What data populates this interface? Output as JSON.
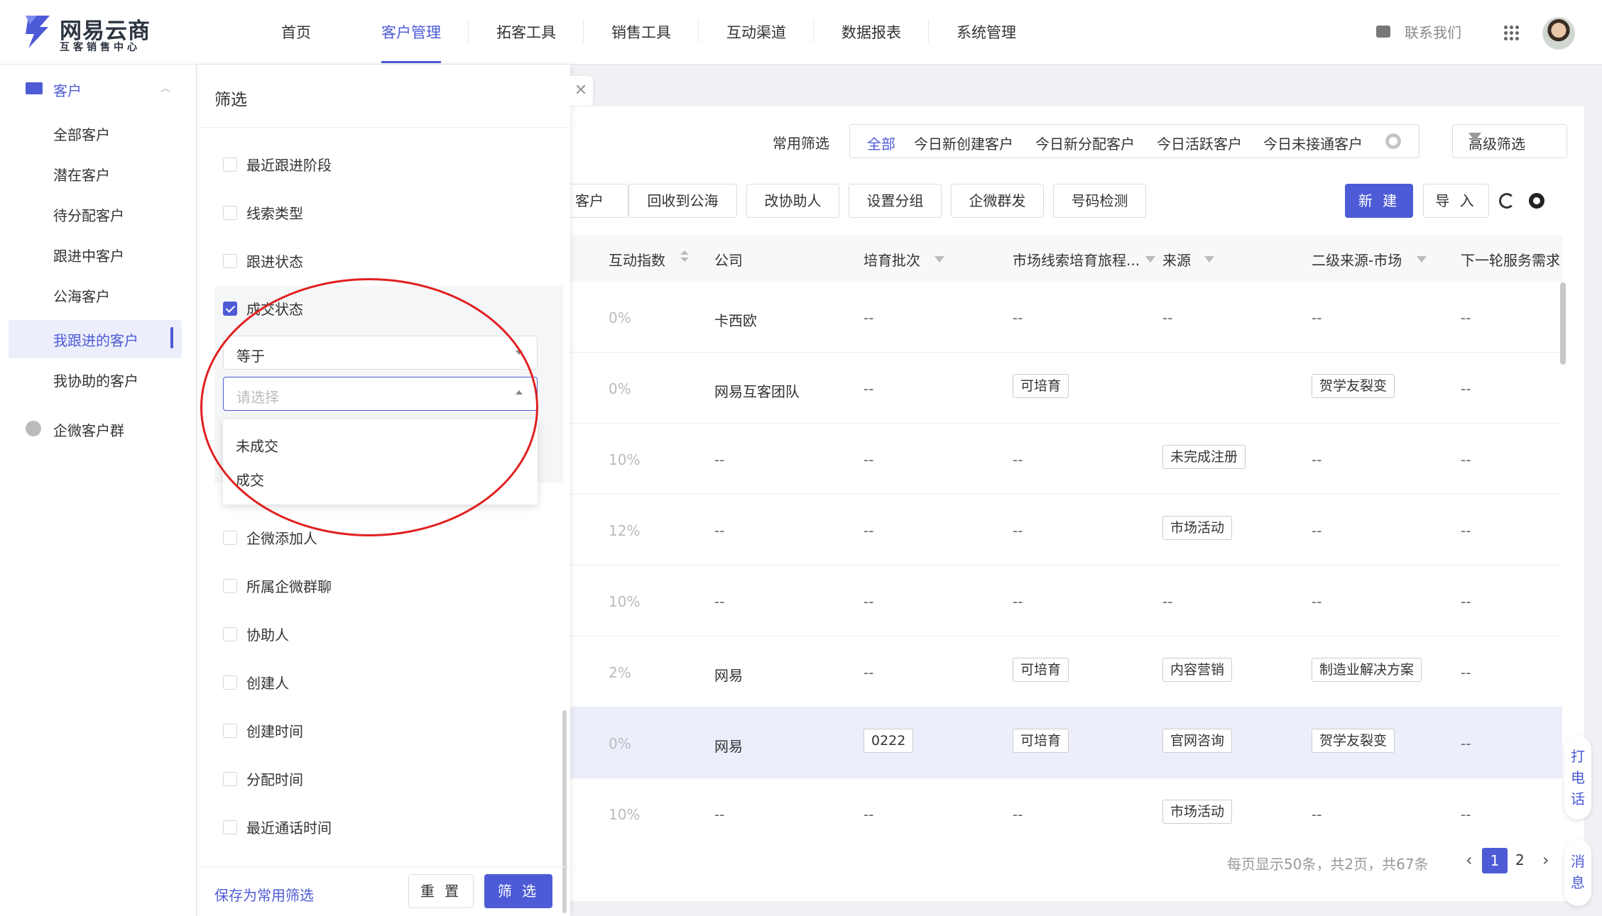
{
  "brand": {
    "name": "网易云商",
    "subtitle": "互客销售中心"
  },
  "nav": {
    "items": [
      "首页",
      "客户管理",
      "拓客工具",
      "销售工具",
      "互动渠道",
      "数据报表",
      "系统管理"
    ],
    "active_index": 1,
    "contact": "联系我们"
  },
  "sidebar": {
    "group": "客户",
    "items": [
      "全部客户",
      "潜在客户",
      "待分配客户",
      "跟进中客户",
      "公海客户",
      "我跟进的客户",
      "我协助的客户"
    ],
    "active": "我跟进的客户",
    "group2": "企微客户群"
  },
  "filter_drawer": {
    "title": "筛选",
    "fields": [
      {
        "label": "最近跟进阶段",
        "checked": false
      },
      {
        "label": "线索类型",
        "checked": false
      },
      {
        "label": "跟进状态",
        "checked": false
      },
      {
        "label": "成交状态",
        "checked": true
      },
      {
        "label": "企微添加人",
        "checked": false
      },
      {
        "label": "所属企微群聊",
        "checked": false
      },
      {
        "label": "协助人",
        "checked": false
      },
      {
        "label": "创建人",
        "checked": false
      },
      {
        "label": "创建时间",
        "checked": false
      },
      {
        "label": "分配时间",
        "checked": false
      },
      {
        "label": "最近通话时间",
        "checked": false
      }
    ],
    "operator": "等于",
    "value_placeholder": "请选择",
    "dropdown_options": [
      "未成交",
      "成交"
    ],
    "save_link": "保存为常用筛选",
    "reset_label": "重 置",
    "filter_label": "筛 选"
  },
  "quick_filter": {
    "label": "常用筛选",
    "items": [
      "全部",
      "今日新创建客户",
      "今日新分配客户",
      "今日活跃客户",
      "今日未接通客户"
    ],
    "active": "全部",
    "advanced": "高级筛选"
  },
  "actions": [
    "客户",
    "回收到公海",
    "改协助人",
    "设置分组",
    "企微群发",
    "号码检测"
  ],
  "new_label": "新 建",
  "import_label": "导 入",
  "table": {
    "columns": [
      "互动指数",
      "公司",
      "培育批次",
      "市场线索培育旅程...",
      "来源",
      "二级来源-市场",
      "下一轮服务需求"
    ],
    "rows": [
      {
        "index": "0%",
        "company": "卡西欧",
        "batch": "--",
        "journey": "--",
        "source": "--",
        "source2": "--",
        "next": "--"
      },
      {
        "index": "0%",
        "company": "网易互客团队",
        "batch": "--",
        "journey": "可培育",
        "source": "",
        "source2": "贺学友裂变",
        "next": "--"
      },
      {
        "index": "10%",
        "company": "--",
        "batch": "--",
        "journey": "--",
        "source": "未完成注册",
        "source2": "--",
        "next": "--"
      },
      {
        "index": "12%",
        "company": "--",
        "batch": "--",
        "journey": "--",
        "source": "市场活动",
        "source2": "--",
        "next": "--"
      },
      {
        "index": "10%",
        "company": "--",
        "batch": "--",
        "journey": "--",
        "source": "--",
        "source2": "--",
        "next": "--"
      },
      {
        "index": "2%",
        "company": "网易",
        "batch": "--",
        "journey": "可培育",
        "source": "内容营销",
        "source2": "制造业解决方案",
        "next": "--"
      },
      {
        "index": "0%",
        "company": "网易",
        "batch": "0222",
        "journey": "可培育",
        "source": "官网咨询",
        "source2": "贺学友裂变",
        "next": "--"
      },
      {
        "index": "10%",
        "company": "--",
        "batch": "--",
        "journey": "--",
        "source": "市场活动",
        "source2": "--",
        "next": "--"
      }
    ]
  },
  "pagination": {
    "info": "每页显示50条，共2页，共67条",
    "current": "1",
    "next_page": "2"
  },
  "float": {
    "call": [
      "打",
      "电",
      "话"
    ],
    "message": [
      "消",
      "息"
    ]
  },
  "colors": {
    "accent": "#4d5bd6",
    "annotation": "#e02020"
  }
}
